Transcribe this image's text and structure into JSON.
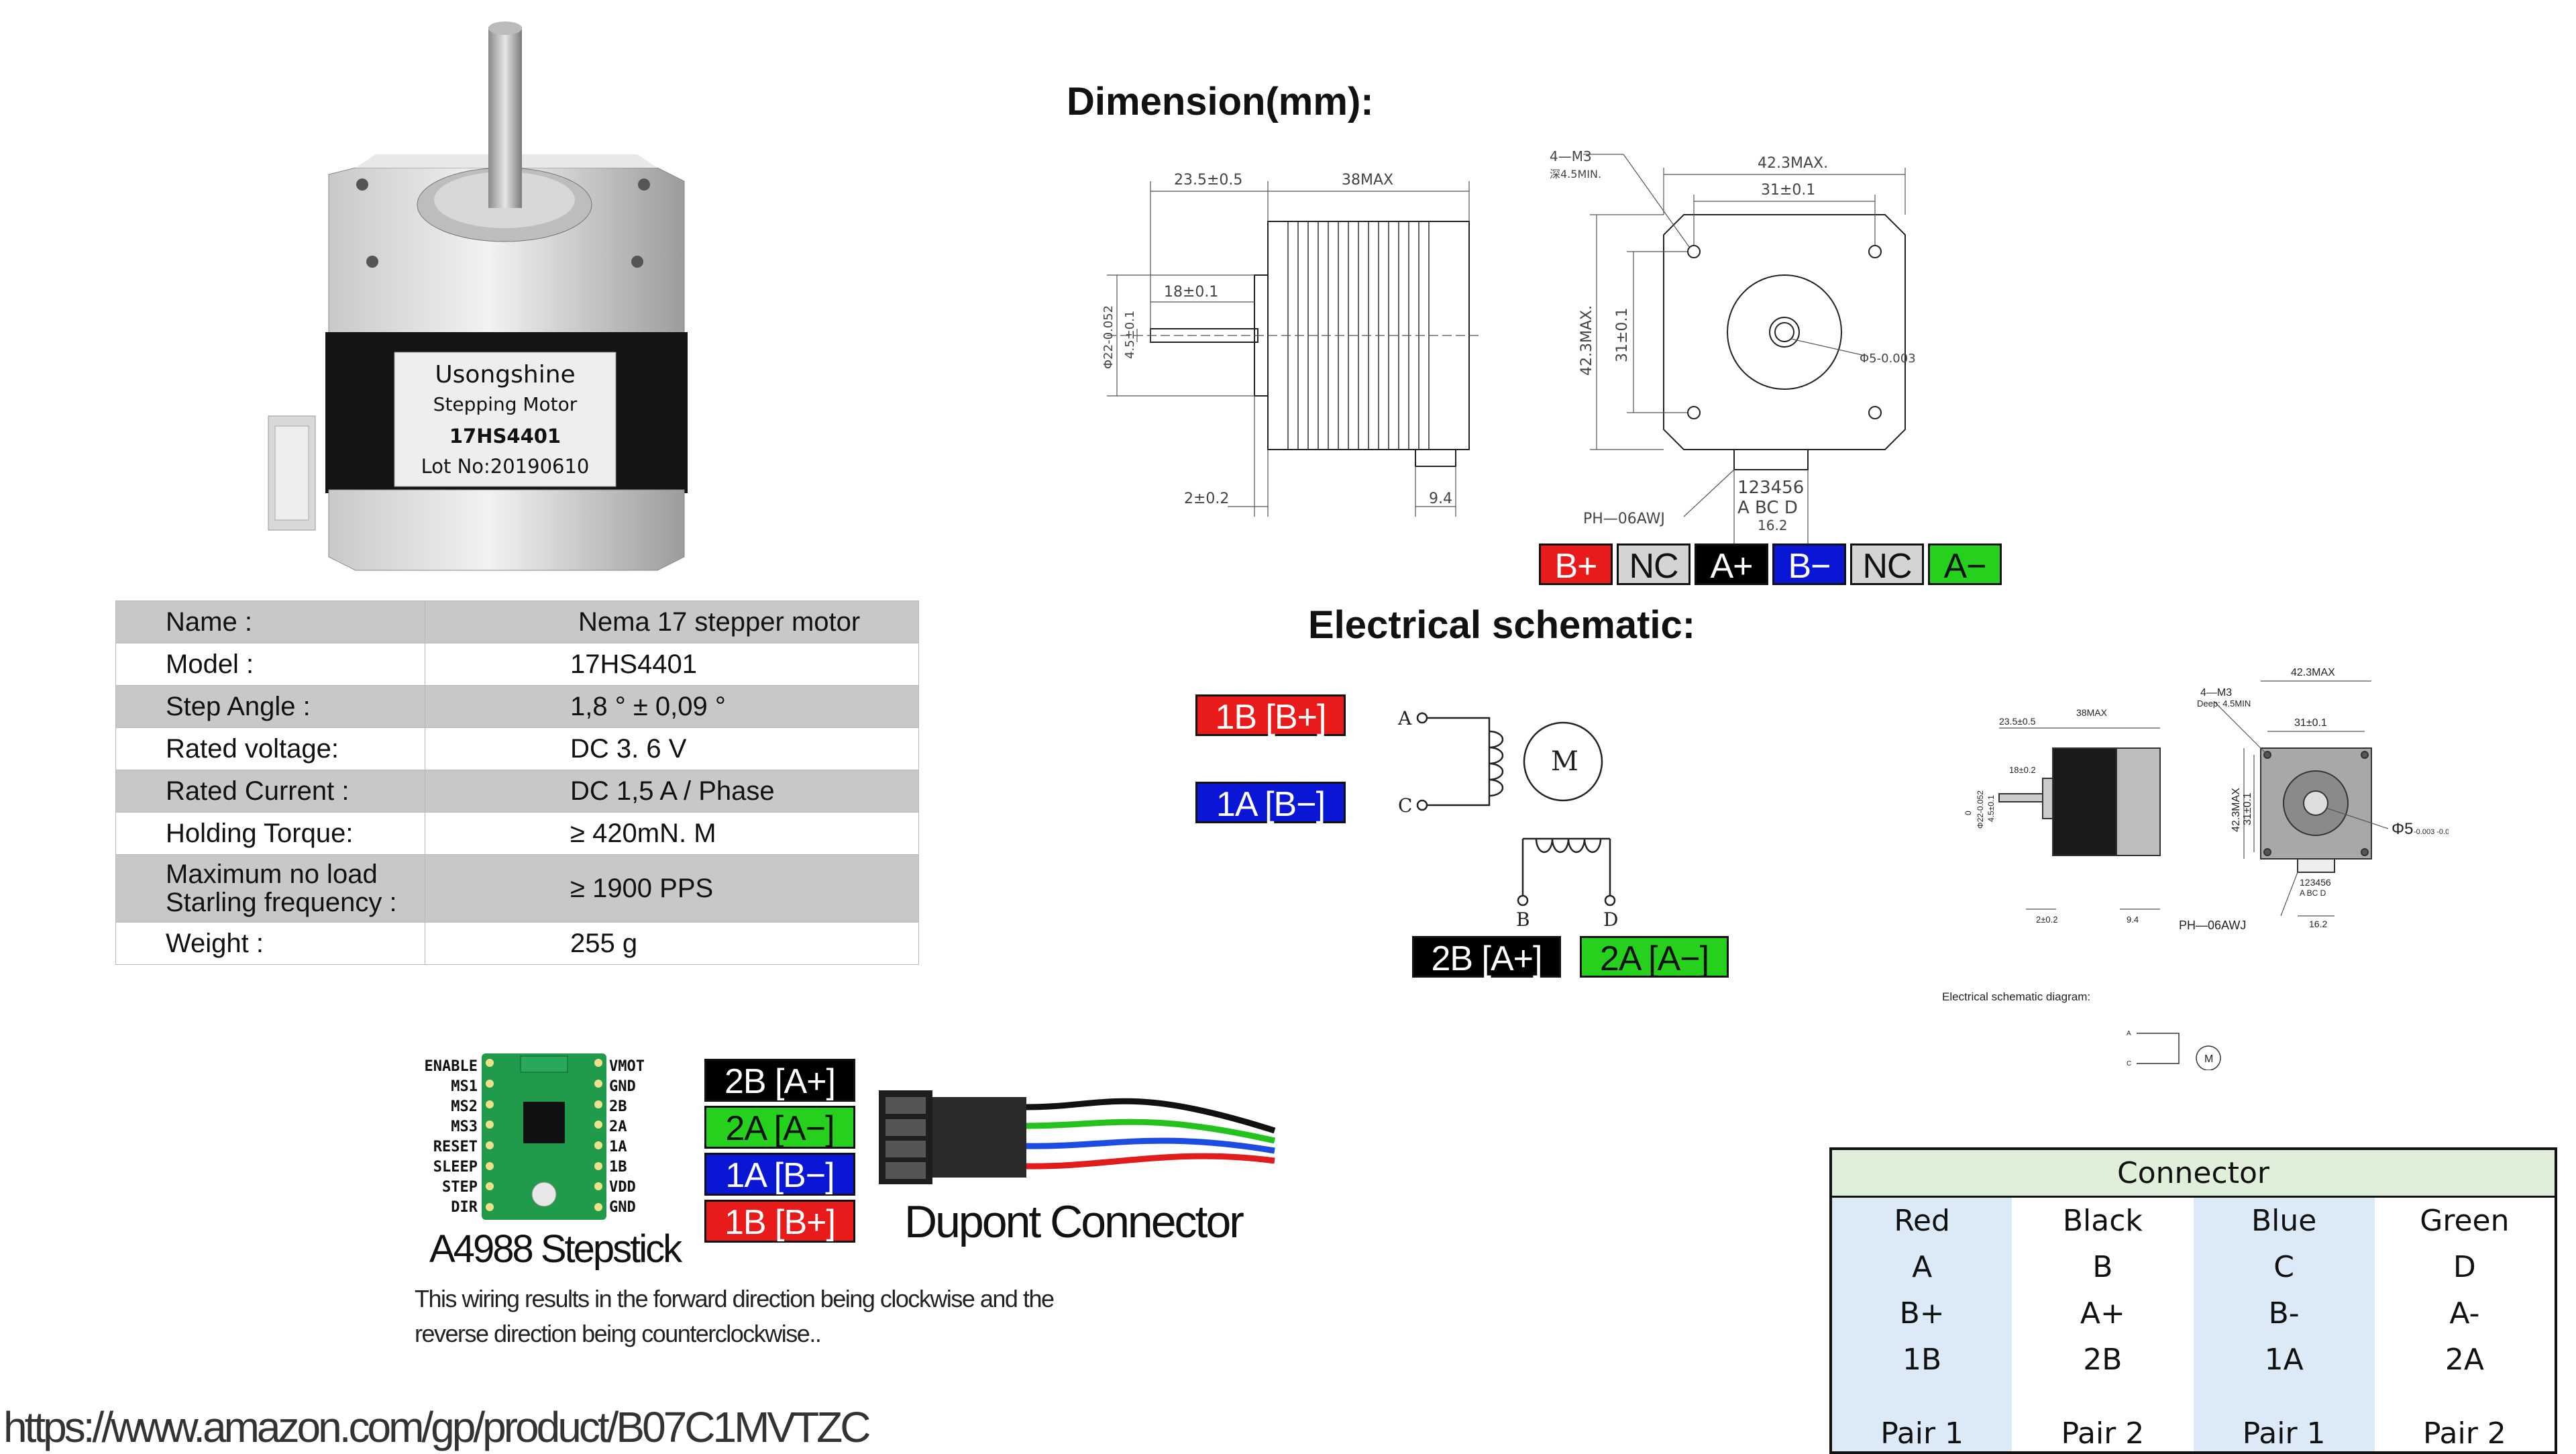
{
  "motor_label": {
    "brand": "Usongshine",
    "type": "Stepping Motor",
    "model": "17HS4401",
    "lot": "Lot No:20190610"
  },
  "headings": {
    "dimension": "Dimension(mm):",
    "electrical": "Electrical schematic:"
  },
  "specs": [
    {
      "name": "Name :",
      "value": "Nema 17 stepper motor"
    },
    {
      "name": "Model :",
      "value": "17HS4401"
    },
    {
      "name": "Step Angle :",
      "value": "1,8 ° ± 0,09 °"
    },
    {
      "name": "Rated voltage:",
      "value": "DC 3. 6 V"
    },
    {
      "name": "Rated Current :",
      "value": "DC 1,5 A / Phase"
    },
    {
      "name": "Holding Torque:",
      "value": "≥ 420mN. M"
    },
    {
      "name": "Maximum no load\nStarling frequency :",
      "value": "≥ 1900 PPS"
    },
    {
      "name": "Weight :",
      "value": "255 g"
    }
  ],
  "drawing": {
    "d_23_5": "23.5±0.5",
    "d_38": "38MAX",
    "d_18": "18±0.1",
    "d_22": "Φ22-0.052",
    "d_4_5": "4.5±0.1",
    "d_2": "2±0.2",
    "d_9_4": "9.4",
    "m3": "4—M3",
    "m3_deep": "深4.5MIN.",
    "d_42_3": "42.3MAX.",
    "d_31": "31±0.1",
    "d_42_3v": "42.3MAX.",
    "d_31v": "31±0.1",
    "d_5": "Φ5-0.003 -0.008",
    "ph": "PH—06AWJ",
    "pins": "123456",
    "abcd": "A  BC  D",
    "d_16_2": "16.2"
  },
  "pin_tags": [
    "B+",
    "NC",
    "A+",
    "B−",
    "NC",
    "A−"
  ],
  "schematic": {
    "tag_1b": "1B [B+]",
    "tag_1a": "1A [B−]",
    "tag_2b": "2B [A+]",
    "tag_2a": "2A [A−]",
    "a": "A",
    "c": "C",
    "b": "B",
    "d": "D",
    "m": "M"
  },
  "small_drawing": {
    "m3": "4—M3",
    "deep": "Deep: 4.5MIN",
    "d_42": "42.3MAX",
    "d_31": "31±0.1",
    "d_23": "23.5±0.5",
    "d_38": "38MAX",
    "d_18": "18±0.2",
    "d_42v": "42.3MAX",
    "d_31v": "31±0.1",
    "d_5": "Φ5",
    "tol": "-0.003 -0.008",
    "pins": "123456",
    "abcd": "A  BC  D",
    "d_2": "2±0.2",
    "d_9_4": "9.4",
    "ph": "PH—06AWJ",
    "d_16": "16.2",
    "caption": "Electrical schematic diagram:",
    "m": "M",
    "a": "A",
    "c": "C",
    "zero": "0",
    "d22": "Φ22-0.052",
    "d45": "4.5±0.1"
  },
  "driver": {
    "left_pins": [
      "ENABLE",
      "MS1",
      "MS2",
      "MS3",
      "RESET",
      "SLEEP",
      "STEP",
      "DIR"
    ],
    "right_pins": [
      "VMOT",
      "GND",
      "2B",
      "2A",
      "1A",
      "1B",
      "VDD",
      "GND"
    ],
    "title": "A4988 Stepstick",
    "wire_tags": [
      "2B [A+]",
      "2A [A−]",
      "1A [B−]",
      "1B [B+]"
    ],
    "connector_title": "Dupont Connector",
    "note_1": "This wiring results in the forward direction being clockwise and the",
    "note_2": "reverse direction being counterclockwise.."
  },
  "connector_table": {
    "title": "Connector",
    "rows": [
      [
        "Red",
        "Black",
        "Blue",
        "Green"
      ],
      [
        "A",
        "B",
        "C",
        "D"
      ],
      [
        "B+",
        "A+",
        "B-",
        "A-"
      ],
      [
        "1B",
        "2B",
        "1A",
        "2A"
      ],
      [
        "Pair 1",
        "Pair 2",
        "Pair 1",
        "Pair 2"
      ]
    ]
  },
  "url": "https://www.amazon.com/gp/product/B07C1MVTZC",
  "colors": {
    "red": "#e81a1a",
    "black": "#000000",
    "blue": "#0a16d6",
    "green": "#25d11d",
    "gray": "#d4d4d4"
  }
}
